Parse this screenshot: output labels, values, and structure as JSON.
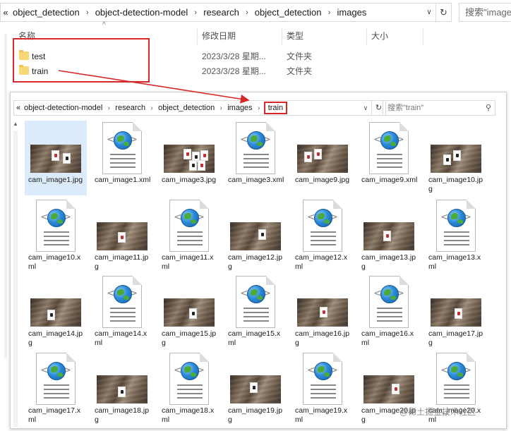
{
  "top_address": {
    "crumbs": [
      "object_detection",
      "object-detection-model",
      "research",
      "object_detection",
      "images"
    ],
    "search_placeholder": "搜索\"images\""
  },
  "columns": {
    "name": "名称",
    "date": "修改日期",
    "type": "类型",
    "size": "大小"
  },
  "top_files": [
    {
      "name": "test",
      "date": "2023/3/28 星期...",
      "type": "文件夹"
    },
    {
      "name": "train",
      "date": "2023/3/28 星期...",
      "type": "文件夹"
    }
  ],
  "inner_address": {
    "crumbs": [
      "object-detection-model",
      "research",
      "object_detection",
      "images",
      "train"
    ],
    "search_placeholder": "搜索\"train\""
  },
  "files": [
    {
      "label": "cam_image1.jpg",
      "kind": "jpg",
      "selected": true
    },
    {
      "label": "cam_image1.xml",
      "kind": "xml"
    },
    {
      "label": "cam_image3.jpg",
      "kind": "jpg"
    },
    {
      "label": "cam_image3.xml",
      "kind": "xml"
    },
    {
      "label": "cam_image9.jpg",
      "kind": "jpg"
    },
    {
      "label": "cam_image9.xml",
      "kind": "xml"
    },
    {
      "label": "cam_image10.jpg",
      "kind": "jpg"
    },
    {
      "label": "cam_image10.xml",
      "kind": "xml"
    },
    {
      "label": "cam_image11.jpg",
      "kind": "jpg"
    },
    {
      "label": "cam_image11.xml",
      "kind": "xml"
    },
    {
      "label": "cam_image12.jpg",
      "kind": "jpg"
    },
    {
      "label": "cam_image12.xml",
      "kind": "xml"
    },
    {
      "label": "cam_image13.jpg",
      "kind": "jpg"
    },
    {
      "label": "cam_image13.xml",
      "kind": "xml"
    },
    {
      "label": "cam_image14.jpg",
      "kind": "jpg"
    },
    {
      "label": "cam_image14.xml",
      "kind": "xml"
    },
    {
      "label": "cam_image15.jpg",
      "kind": "jpg"
    },
    {
      "label": "cam_image15.xml",
      "kind": "xml"
    },
    {
      "label": "cam_image16.jpg",
      "kind": "jpg"
    },
    {
      "label": "cam_image16.xml",
      "kind": "xml"
    },
    {
      "label": "cam_image17.jpg",
      "kind": "jpg"
    },
    {
      "label": "cam_image17.xml",
      "kind": "xml"
    },
    {
      "label": "cam_image18.jpg",
      "kind": "jpg"
    },
    {
      "label": "cam_image18.xml",
      "kind": "xml"
    },
    {
      "label": "cam_image19.jpg",
      "kind": "jpg"
    },
    {
      "label": "cam_image19.xml",
      "kind": "xml"
    },
    {
      "label": "cam_image20.jpg",
      "kind": "jpg"
    },
    {
      "label": "cam_image20.xml",
      "kind": "xml"
    }
  ],
  "watermark": "@稀土掘金技术社区",
  "colors": {
    "highlight_red": "#d62828",
    "selection": "#dcebfb",
    "folder": "#f8d775"
  }
}
